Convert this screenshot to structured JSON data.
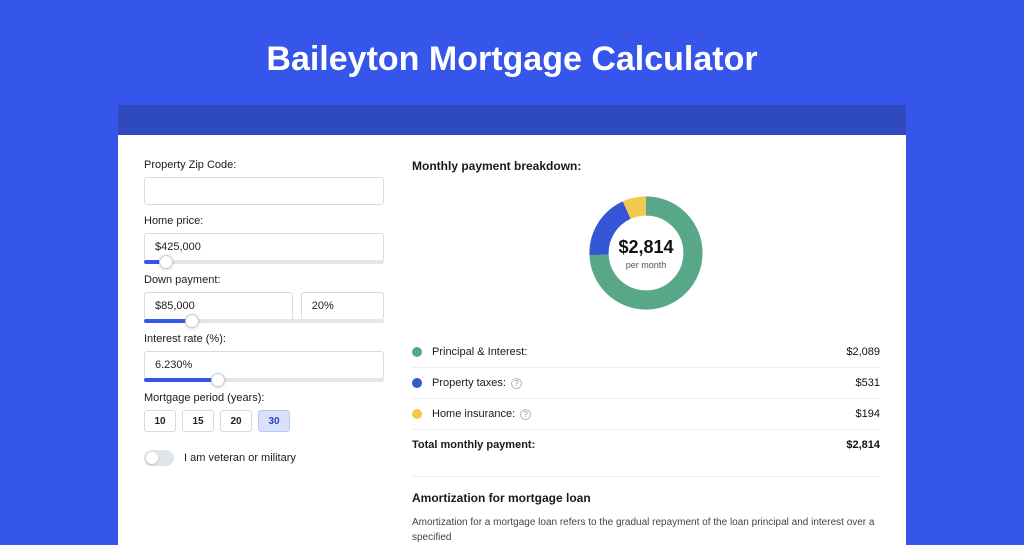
{
  "page_title": "Baileyton Mortgage Calculator",
  "form": {
    "zip_label": "Property Zip Code:",
    "zip_value": "",
    "home_price_label": "Home price:",
    "home_price_value": "$425,000",
    "home_price_slider_pct": 9,
    "down_payment_label": "Down payment:",
    "down_payment_value": "$85,000",
    "down_payment_pct_value": "20%",
    "down_payment_slider_pct": 20,
    "interest_label": "Interest rate (%):",
    "interest_value": "6.230%",
    "interest_slider_pct": 31,
    "period_label": "Mortgage period (years):",
    "period_options": [
      "10",
      "15",
      "20",
      "30"
    ],
    "period_selected": "30",
    "veteran_label": "I am veteran or military"
  },
  "breakdown": {
    "title": "Monthly payment breakdown:",
    "center_amount": "$2,814",
    "center_sub": "per month",
    "items": [
      {
        "color": "green",
        "label": "Principal & Interest:",
        "value": "$2,089",
        "info": false
      },
      {
        "color": "blue",
        "label": "Property taxes:",
        "value": "$531",
        "info": true
      },
      {
        "color": "yellow",
        "label": "Home insurance:",
        "value": "$194",
        "info": true
      }
    ],
    "total_label": "Total monthly payment:",
    "total_value": "$2,814"
  },
  "amort": {
    "heading": "Amortization for mortgage loan",
    "body": "Amortization for a mortgage loan refers to the gradual repayment of the loan principal and interest over a specified"
  },
  "chart_data": {
    "type": "pie",
    "title": "Monthly payment breakdown",
    "series": [
      {
        "name": "Principal & Interest",
        "value": 2089,
        "color": "#59a789"
      },
      {
        "name": "Property taxes",
        "value": 531,
        "color": "#3457d5"
      },
      {
        "name": "Home insurance",
        "value": 194,
        "color": "#f0c94d"
      }
    ],
    "total": 2814,
    "center_label": "$2,814 per month"
  },
  "colors": {
    "bg": "#3555eb",
    "band": "#2f49bf",
    "green": "#59a789",
    "blue": "#3457d5",
    "yellow": "#f0c94d"
  }
}
